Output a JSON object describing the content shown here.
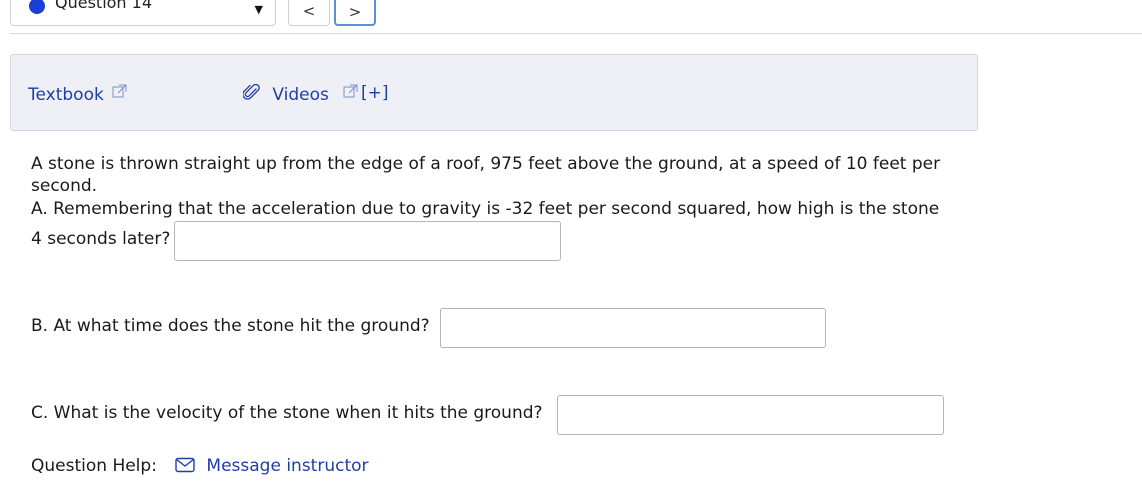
{
  "header": {
    "question_label": "Question 14",
    "prev_glyph": "<",
    "next_glyph": ">"
  },
  "resources": {
    "textbook": "Textbook",
    "videos": "Videos",
    "expand": "[+]"
  },
  "problem": {
    "intro_line1": "A stone is thrown straight up from the edge of a roof, 975 feet above the ground, at a speed of 10 feet per",
    "intro_line2": "second.",
    "part_a_line1": "A. Remembering that the acceleration due to gravity is -32 feet per second squared, how high is the stone",
    "part_a_line2": "4 seconds later?",
    "part_b": "B. At what time does the stone hit the ground?",
    "part_c": "C. What is the velocity of the stone when it hits the ground?",
    "answers": {
      "a": "",
      "b": "",
      "c": ""
    }
  },
  "help": {
    "label": "Question Help:",
    "message": "Message instructor"
  },
  "colors": {
    "accent": "#1b3fd6",
    "link": "#1f3ea8",
    "panel": "#eef0f6"
  },
  "icons": [
    "circle-dot-icon",
    "dropdown-caret-icon",
    "external-link-icon",
    "paperclip-icon",
    "envelope-icon"
  ]
}
